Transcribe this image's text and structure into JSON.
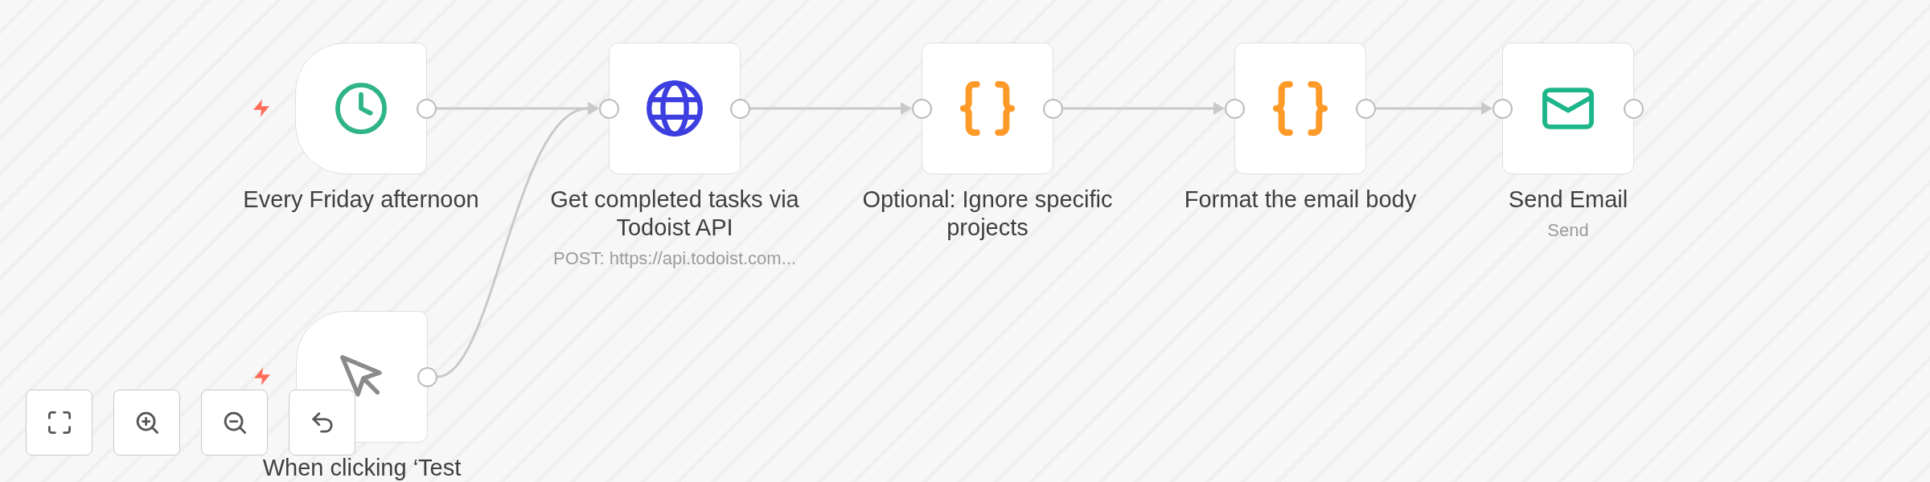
{
  "nodes": [
    {
      "kind": "schedule",
      "label": "Every Friday afternoon"
    },
    {
      "kind": "http",
      "label": "Get completed tasks via Todoist API",
      "subtitle": "POST: https://api.todoist.com..."
    },
    {
      "kind": "code",
      "label": "Optional: Ignore specific projects"
    },
    {
      "kind": "code",
      "label": "Format the email body"
    },
    {
      "kind": "email",
      "label": "Send Email",
      "subtitle": "Send"
    },
    {
      "kind": "manual",
      "label": "When clicking ‘Test"
    }
  ],
  "canvas_controls": [
    {
      "kind": "fit"
    },
    {
      "kind": "zoom-in"
    },
    {
      "kind": "zoom-out"
    },
    {
      "kind": "reset"
    }
  ]
}
